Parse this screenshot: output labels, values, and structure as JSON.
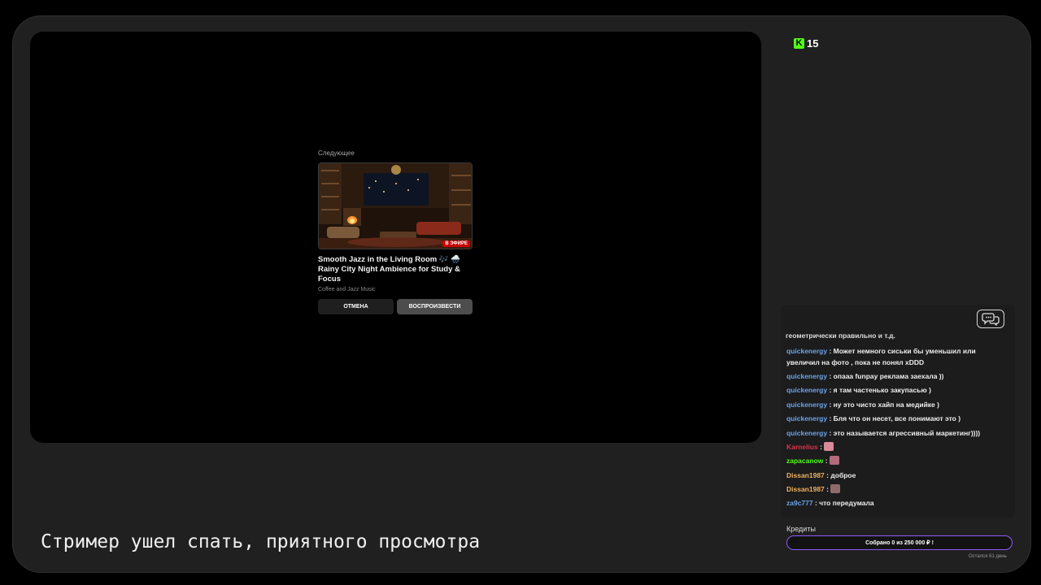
{
  "player": {
    "next_heading": "Следующее",
    "live_badge": "В ЭФИРЕ",
    "video_title": "Smooth Jazz in the Living Room 🎶 🌧️ Rainy City Night Ambience for Study & Focus",
    "channel": "Coffee and Jazz Music",
    "cancel_label": "ОТМЕНА",
    "play_label": "ВОСПРОИЗВЕСТИ"
  },
  "status_text": "Стример ушел спать, приятного просмотра",
  "viewers": {
    "logo_icon": "kick-logo-icon",
    "logo_letter": "K",
    "count": "15"
  },
  "chat": {
    "toggle_icon": "chat-bubbles-icon",
    "cut_line": "геометрически правильно и т.д.",
    "messages": [
      {
        "user": "quickenergy",
        "sep": " : ",
        "text": "Может немного сиськи бы уменьшил или увеличил на фото , пока не понял xDDD",
        "color": "#6ba3e8"
      },
      {
        "user": "quickenergy",
        "sep": " : ",
        "text": "опааа funpay реклама заехала ))",
        "color": "#6ba3e8"
      },
      {
        "user": "quickenergy",
        "sep": " : ",
        "text": "я там частенько закупаcью )",
        "color": "#6ba3e8"
      },
      {
        "user": "quickenergy",
        "sep": " : ",
        "text": "ну это чисто хайп на медийке )",
        "color": "#6ba3e8"
      },
      {
        "user": "quickenergy",
        "sep": " : ",
        "text": "Бля что он несет, все понимают это )",
        "color": "#6ba3e8"
      },
      {
        "user": "quickenergy",
        "sep": " : ",
        "text": "это называется агрессивный маркетинг))))",
        "color": "#6ba3e8"
      },
      {
        "user": "Karnelius",
        "sep": " : ",
        "text": "",
        "color": "#e0304a",
        "emote": "pink-emote-icon",
        "emote_color": "#d88a9a"
      },
      {
        "user": "zapacanow",
        "sep": " : ",
        "text": "",
        "color": "#53fc18",
        "emote": "pink-emote-icon",
        "emote_color": "#b36b7a"
      },
      {
        "user": "Dissan1987",
        "sep": " : ",
        "text": "доброе",
        "color": "#f0b060"
      },
      {
        "user": "Dissan1987",
        "sep": " : ",
        "text": "",
        "color": "#f0b060",
        "emote": "cat-emote-icon",
        "emote_color": "#8e6b6b"
      },
      {
        "user": "za9c777",
        "sep": " : ",
        "text": "что передумала",
        "color": "#6ba3e8"
      }
    ]
  },
  "credits": {
    "label": "Кредиты",
    "progress_text": "Собрано 0  из 250 000 ₽ !",
    "progress": 0,
    "days_left": "Остался 61 день",
    "accent": "#8b5cf6"
  }
}
